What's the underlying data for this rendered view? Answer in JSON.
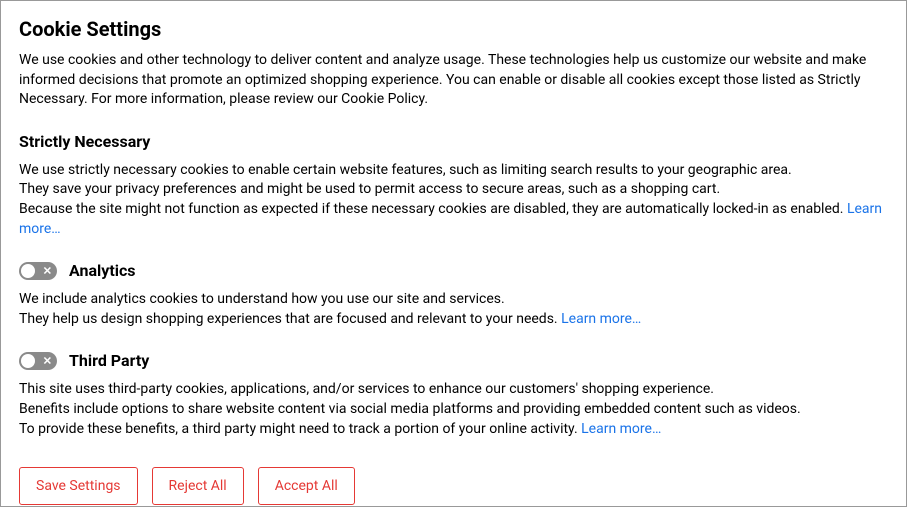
{
  "title": "Cookie Settings",
  "intro": "We use cookies and other technology to deliver content and analyze usage. These technologies help us customize our website and make informed decisions that promote an optimized shopping experience.  You can enable or disable all cookies except those listed as Strictly Necessary. For more information, please review our Cookie Policy.",
  "sections": {
    "necessary": {
      "title": "Strictly Necessary",
      "body": "We use strictly necessary cookies to enable certain website features, such as limiting search results to your geographic area.\nThey save your privacy preferences and might be used to permit access to secure areas, such as a shopping cart.\nBecause the site might not function as expected if these necessary cookies are disabled, they are automatically locked-in as enabled. ",
      "learn_more": "Learn more…"
    },
    "analytics": {
      "title": "Analytics",
      "enabled": false,
      "body": "We include analytics cookies to understand how you use our site and services.\nThey help us design shopping experiences that are focused and relevant to your needs. ",
      "learn_more": "Learn more…"
    },
    "thirdparty": {
      "title": "Third Party",
      "enabled": false,
      "body": "This site uses third-party cookies, applications, and/or services to enhance our customers' shopping experience.\nBenefits include options to share website content via social media platforms and providing embedded content such as videos.\nTo provide these benefits, a third party might need to track a portion of your online activity. ",
      "learn_more": "Learn more…"
    }
  },
  "buttons": {
    "save": "Save Settings",
    "reject": "Reject All",
    "accept": "Accept All"
  }
}
